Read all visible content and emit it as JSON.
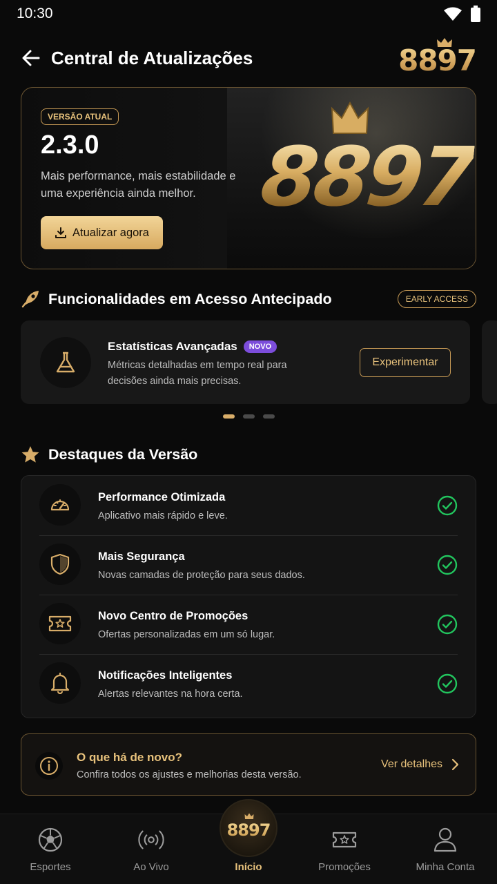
{
  "status_bar": {
    "time": "10:30"
  },
  "header": {
    "title": "Central de Atualizações",
    "brand": "8897"
  },
  "hero": {
    "badge": "VERSÃO ATUAL",
    "version": "2.3.0",
    "description": "Mais performance, mais estabilidade e uma experiência ainda melhor.",
    "update_button": "Atualizar agora",
    "art_text": "8897"
  },
  "early_access": {
    "title": "Funcionalidades em Acesso Antecipado",
    "badge": "EARLY ACCESS",
    "card": {
      "title": "Estatísticas Avançadas",
      "badge": "NOVO",
      "description": "Métricas detalhadas em tempo real para decisões ainda mais precisas.",
      "button": "Experimentar"
    },
    "dots_total": 3,
    "dots_active_index": 0
  },
  "highlights": {
    "title": "Destaques da Versão",
    "items": [
      {
        "icon": "speedometer-icon",
        "title": "Performance Otimizada",
        "description": "Aplicativo mais rápido e leve."
      },
      {
        "icon": "shield-icon",
        "title": "Mais Segurança",
        "description": "Novas camadas de proteção para seus dados."
      },
      {
        "icon": "ticket-icon",
        "title": "Novo Centro de Promoções",
        "description": "Ofertas personalizadas em um só lugar."
      },
      {
        "icon": "bell-icon",
        "title": "Notificações Inteligentes",
        "description": "Alertas relevantes na hora certa."
      }
    ]
  },
  "news": {
    "title": "O que há de novo?",
    "description": "Confira todos os ajustes e melhorias desta versão.",
    "link": "Ver detalhes"
  },
  "bottom_nav": {
    "items": [
      {
        "label": "Esportes",
        "icon": "soccer-ball-icon"
      },
      {
        "label": "Ao Vivo",
        "icon": "broadcast-icon"
      },
      {
        "label": "Início",
        "icon": "home-brand-icon",
        "active": true
      },
      {
        "label": "Promoções",
        "icon": "ticket-icon"
      },
      {
        "label": "Minha Conta",
        "icon": "user-icon"
      }
    ],
    "center_brand": "8897"
  },
  "colors": {
    "accent": "#d8ad69",
    "success": "#22c55e",
    "badge_purple": "#7c4ddb"
  }
}
